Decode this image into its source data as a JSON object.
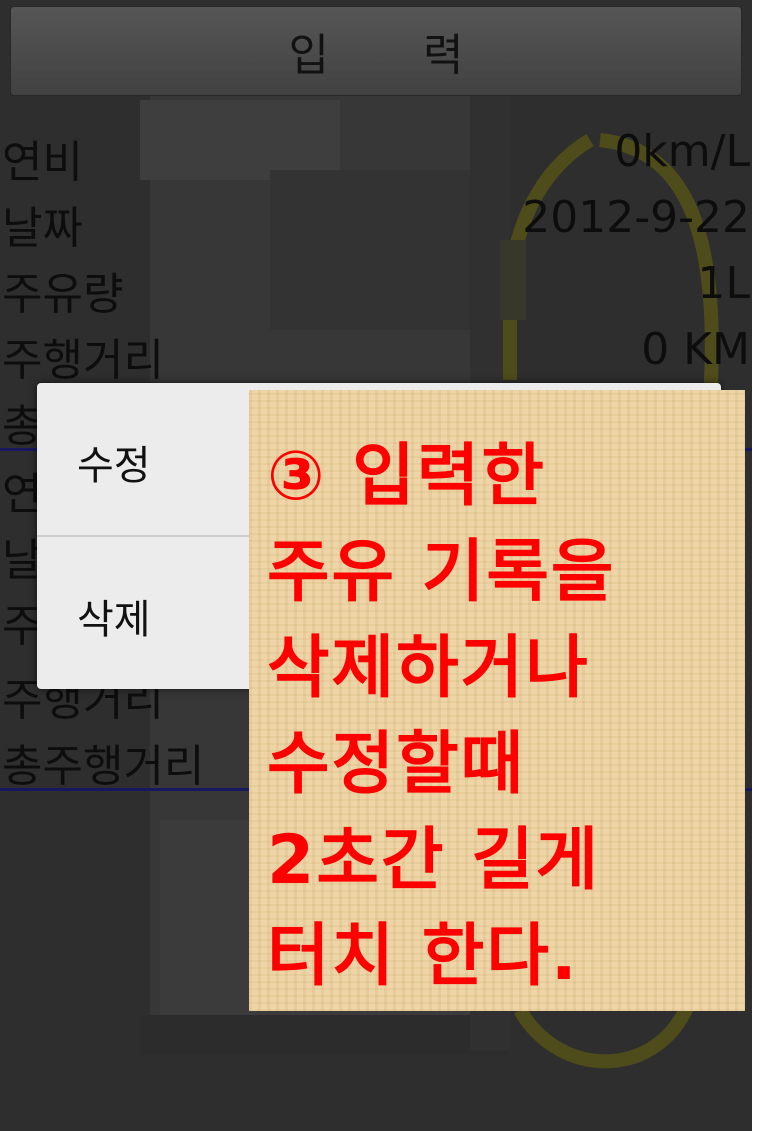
{
  "header": {
    "title": "입 력"
  },
  "rows_top": [
    {
      "label": "연비",
      "value": "0km/L"
    },
    {
      "label": "날짜",
      "value": "2012-9-22"
    },
    {
      "label": "주유량",
      "value": "1L"
    },
    {
      "label": "주행거리",
      "value": "0 KM"
    },
    {
      "label": "총",
      "value": ""
    }
  ],
  "rows_bottom": [
    {
      "label": "연",
      "value": ""
    },
    {
      "label": "날",
      "value": ""
    },
    {
      "label": "주",
      "value": ""
    },
    {
      "label": "주행거리",
      "value": ""
    },
    {
      "label": "총주행거리",
      "value": ""
    }
  ],
  "context_menu": {
    "edit_label": "수정",
    "delete_label": "삭제"
  },
  "annotation": {
    "lines": [
      "③ 입력한",
      "주유 기록을",
      "삭제하거나",
      "수정할때",
      "2초간 길게",
      "터치 한다."
    ],
    "color": "#ff0000",
    "background": "#ecd19f"
  }
}
